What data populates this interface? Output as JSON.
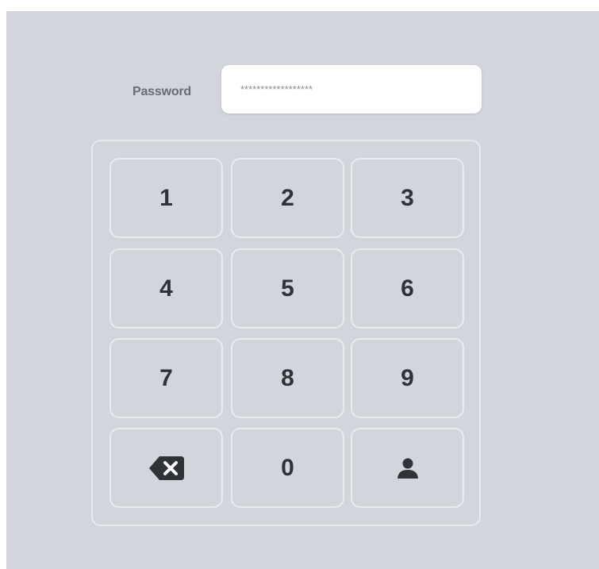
{
  "password": {
    "label": "Password",
    "value": "******************",
    "placeholder": ""
  },
  "keypad": {
    "keys": [
      "1",
      "2",
      "3",
      "4",
      "5",
      "6",
      "7",
      "8",
      "9",
      "0"
    ],
    "backspace_icon": "backspace-icon",
    "user_icon": "user-icon"
  },
  "colors": {
    "background": "#d3d5dd",
    "key_border": "#eaebef",
    "key_text": "#2f3237",
    "label_text": "#676b72"
  }
}
